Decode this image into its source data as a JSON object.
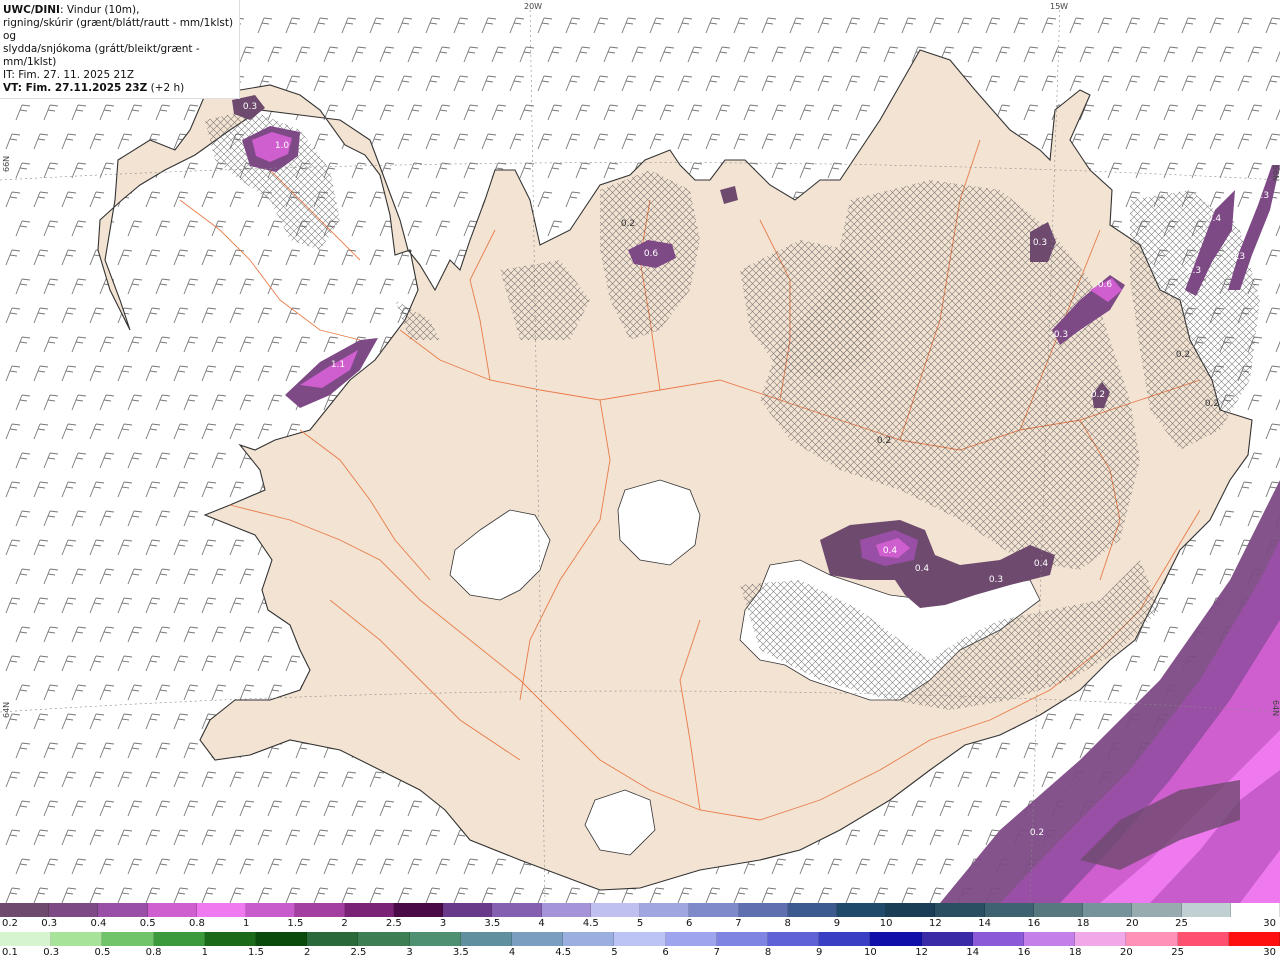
{
  "header": {
    "product": "UWC/DINI",
    "description_1": ": Vindur (10m),",
    "description_2": "rigning/skúrir (grænt/blátt/rautt - mm/1klst) og",
    "description_3": "slydda/snjókoma (grátt/bleikt/grænt - mm/1klst)",
    "init_time": "IT: Fim. 27. 11. 2025 21Z",
    "valid_prefix": "VT: Fim. 27.11.2025 23Z",
    "valid_suffix": " (+2 h)"
  },
  "graticule": {
    "lon_20w": "20W",
    "lon_15w": "15W",
    "lat_66n_left": "66N",
    "lat_64n_left": "64N",
    "lat_66n_right": "66N",
    "lat_64n_right": "64N"
  },
  "map_labels": [
    "0.3",
    "1.0",
    "1.1",
    "0.2",
    "0.6",
    "0.3",
    "0.6",
    "0.3",
    "0.4",
    "0.3",
    "0.3",
    "0.3",
    "0.2",
    "0.2",
    "0.2",
    "0.2",
    "0.4",
    "0.4",
    "0.3",
    "0.4",
    "0.2"
  ],
  "colors": {
    "land": "#f3e3d3",
    "glacier": "#ffffff",
    "roads": "#e8703a",
    "coast": "#333333",
    "sea": "#ffffff"
  },
  "legend_snow": {
    "labels": [
      "0.2",
      "0.3",
      "0.4",
      "0.5",
      "0.8",
      "1",
      "1.5",
      "2",
      "2.5",
      "3",
      "3.5",
      "4",
      "4.5",
      "5",
      "6",
      "7",
      "8",
      "9",
      "10",
      "12",
      "14",
      "16",
      "18",
      "20",
      "25",
      "30"
    ],
    "colors": [
      "#6e4a6e",
      "#7e4a86",
      "#9a4fa6",
      "#cf5fcf",
      "#ef7aef",
      "#c85ccd",
      "#a3409f",
      "#7a2276",
      "#4a0a48",
      "#6a3a8a",
      "#8660b0",
      "#a595d8",
      "#bfc0f0",
      "#9fa6e0",
      "#7f8acb",
      "#5f70b0",
      "#3d5a8f",
      "#1f4a6a",
      "#1a3e56",
      "#2a4e62",
      "#3e6270",
      "#58787f",
      "#76929a",
      "#98acb0",
      "#c0d0d2",
      "#ffffff"
    ]
  },
  "legend_rain": {
    "labels": [
      "0.1",
      "0.3",
      "0.5",
      "0.8",
      "1",
      "1.5",
      "2",
      "2.5",
      "3",
      "3.5",
      "4",
      "4.5",
      "5",
      "6",
      "7",
      "8",
      "9",
      "10",
      "12",
      "14",
      "16",
      "18",
      "20",
      "25",
      "30"
    ],
    "colors": [
      "#d6f5cf",
      "#a8e39a",
      "#72c46a",
      "#3d9a3c",
      "#1a6a1a",
      "#0a4a0a",
      "#2a6a3a",
      "#3e7e55",
      "#4f8f72",
      "#6090a0",
      "#7a9ec0",
      "#9aaee0",
      "#bcc4f6",
      "#9ea4ee",
      "#7f84e2",
      "#5e62d4",
      "#3a3ec4",
      "#1010a8",
      "#3a2aa8",
      "#8a5ad8",
      "#c480e8",
      "#f0a8e8",
      "#ff90b8",
      "#ff5070",
      "#ff1010"
    ]
  }
}
